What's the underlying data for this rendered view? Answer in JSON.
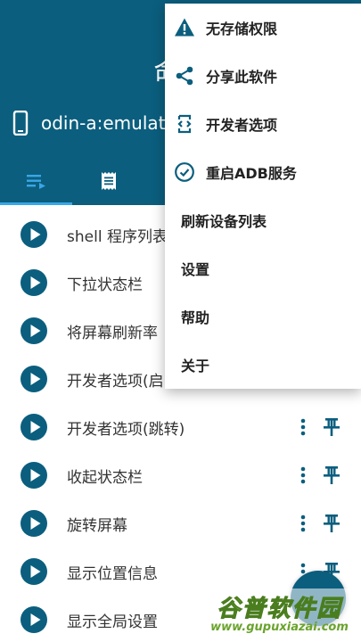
{
  "header": {
    "title": "命令",
    "device": "odin-a:emulato"
  },
  "tabs": [
    {
      "icon": "list-play-icon",
      "selected": true
    },
    {
      "icon": "receipt-icon",
      "selected": false
    }
  ],
  "commands": [
    {
      "label": "shell 程序列表"
    },
    {
      "label": "下拉状态栏"
    },
    {
      "label": "将屏幕刷新率"
    },
    {
      "label": "开发者选项(启"
    },
    {
      "label": "开发者选项(跳转)"
    },
    {
      "label": "收起状态栏"
    },
    {
      "label": "旋转屏幕"
    },
    {
      "label": "显示位置信息"
    },
    {
      "label": "显示全局设置"
    }
  ],
  "menu": {
    "items": [
      {
        "label": "无存储权限",
        "icon": "warning-icon"
      },
      {
        "label": "分享此软件",
        "icon": "share-icon"
      },
      {
        "label": "开发者选项",
        "icon": "developer-mode-icon"
      },
      {
        "label": "重启ADB服务",
        "icon": "check-circle-icon"
      },
      {
        "label": "刷新设备列表",
        "icon": ""
      },
      {
        "label": "设置",
        "icon": ""
      },
      {
        "label": "帮助",
        "icon": ""
      },
      {
        "label": "关于",
        "icon": ""
      }
    ]
  },
  "watermark": {
    "name": "谷普软件园",
    "url": "www.gupuxiazai.com"
  },
  "colors": {
    "primary": "#0b5e7e",
    "accent": "#3aa7e6",
    "icon": "#0b5e7e"
  }
}
